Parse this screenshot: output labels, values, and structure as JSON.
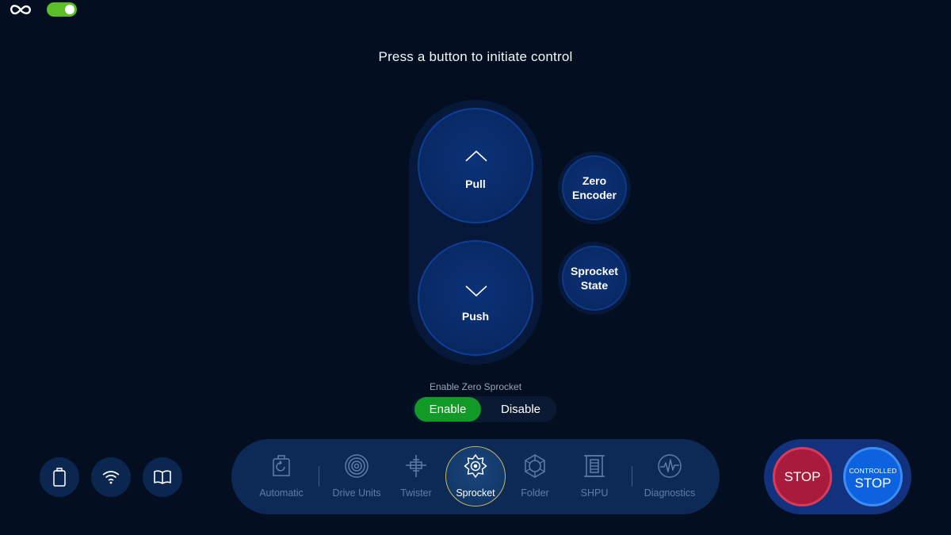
{
  "top": {
    "logo_icon": "infinity-icon",
    "toggle_state": "on",
    "toggle_color": "#5cbf2a"
  },
  "prompt": "Press a button to initiate control",
  "controls": {
    "pull_label": "Pull",
    "push_label": "Push",
    "zero_encoder_label": [
      "Zero",
      "Encoder"
    ],
    "sprocket_state_label": [
      "Sprocket",
      "State"
    ]
  },
  "zero_sprocket": {
    "title": "Enable Zero Sprocket",
    "enable_label": "Enable",
    "disable_label": "Disable",
    "selected": "Enable",
    "selected_color": "#119a25"
  },
  "side_buttons": [
    {
      "icon": "battery-icon"
    },
    {
      "icon": "wifi-icon"
    },
    {
      "icon": "book-icon"
    }
  ],
  "nav": {
    "items": [
      {
        "label": "Automatic",
        "icon": "automatic-icon"
      },
      {
        "label": "Drive Units",
        "icon": "drive-units-icon"
      },
      {
        "label": "Twister",
        "icon": "twister-icon"
      },
      {
        "label": "Sprocket",
        "icon": "sprocket-icon"
      },
      {
        "label": "Folder",
        "icon": "folder-icon"
      },
      {
        "label": "SHPU",
        "icon": "shpu-icon"
      },
      {
        "label": "Diagnostics",
        "icon": "diagnostics-icon"
      }
    ],
    "active": "Sprocket"
  },
  "stop": {
    "stop_label": "STOP",
    "controlled_small": "CONTROLLED",
    "controlled_big": "STOP",
    "stop_color": "#a81b3c",
    "controlled_color": "#0d63df"
  }
}
